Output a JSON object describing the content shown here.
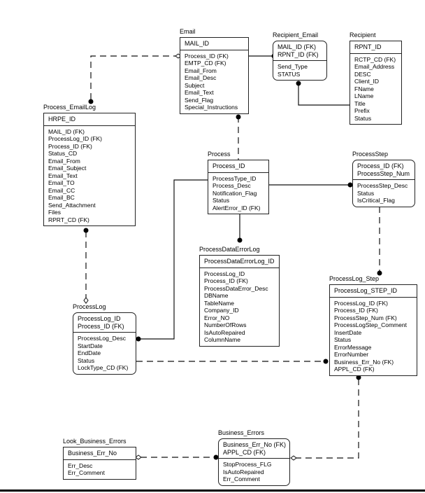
{
  "diagram": {
    "type": "entity-relationship",
    "entities": {
      "email": {
        "name": "Email",
        "keys": [
          "MAIL_ID"
        ],
        "attributes": [
          "Process_ID (FK)",
          "EMTP_CD (FK)",
          "Email_From",
          "Email_Desc",
          "Subject",
          "Email_Text",
          "Send_Flag",
          "Special_Instructions"
        ]
      },
      "recipient_email": {
        "name": "Recipient_Email",
        "keys": [
          "MAIL_ID (FK)",
          "RPNT_ID (FK)"
        ],
        "attributes": [
          "Send_Type",
          "STATUS"
        ]
      },
      "recipient": {
        "name": "Recipient",
        "keys": [
          "RPNT_ID"
        ],
        "attributes": [
          "RCTP_CD (FK)",
          "Email_Address",
          "DESC",
          "Client_ID",
          "FName",
          "LName",
          "Title",
          "Prefix",
          "Status"
        ]
      },
      "process_emaillog": {
        "name": "Process_EmailLog",
        "keys": [
          "HRPE_ID"
        ],
        "attributes": [
          "MAIL_ID (FK)",
          "ProcessLog_ID (FK)",
          "Process_ID (FK)",
          "Status_CD",
          "Email_From",
          "Email_Subject",
          "Email_Text",
          "Email_TO",
          "Email_CC",
          "Email_BC",
          "Send_Attachment",
          "Files",
          "RPRT_CD (FK)"
        ]
      },
      "process": {
        "name": "Process",
        "keys": [
          "Process_ID"
        ],
        "attributes": [
          "ProcessType_ID",
          "Process_Desc",
          "Notification_Flag",
          "Status",
          "AlertError_ID (FK)"
        ]
      },
      "process_step": {
        "name": "ProcessStep",
        "keys": [
          "Process_ID (FK)",
          "ProcessStep_Num"
        ],
        "attributes": [
          "ProcessStep_Desc",
          "Status",
          "IsCritical_Flag"
        ]
      },
      "process_data_error_log": {
        "name": "ProcessDataErrorLog",
        "keys": [
          "ProcessDataErrorLog_ID"
        ],
        "attributes": [
          "ProcessLog_ID",
          "Process_ID (FK)",
          "ProcessDataError_Desc",
          "DBName",
          "TableName",
          "Company_ID",
          "Error_NO",
          "NumberOfRows",
          "IsAutoRepaired",
          "ColumnName"
        ]
      },
      "process_log_step": {
        "name": "ProcessLog_Step",
        "keys": [
          "ProcessLog_STEP_ID"
        ],
        "attributes": [
          "ProcessLog_ID (FK)",
          "Process_ID (FK)",
          "ProcessStep_Num (FK)",
          "ProcessLogStep_Comment",
          "InsertDate",
          "Status",
          "ErrorMessage",
          "ErrorNumber",
          "Business_Err_No (FK)",
          "APPL_CD (FK)"
        ]
      },
      "process_log": {
        "name": "ProcessLog",
        "keys": [
          "ProcessLog_ID",
          "Process_ID (FK)"
        ],
        "attributes": [
          "ProcessLog_Desc",
          "StartDate",
          "EndDate",
          "Status",
          "LockType_CD (FK)"
        ]
      },
      "look_business_errors": {
        "name": "Look_Business_Errors",
        "keys": [
          "Business_Err_No"
        ],
        "attributes": [
          "Err_Desc",
          "Err_Comment"
        ]
      },
      "business_errors": {
        "name": "Business_Errors",
        "keys": [
          "Business_Err_No (FK)",
          "APPL_CD (FK)"
        ],
        "attributes": [
          "StopProcess_FLG",
          "IsAutoRepaired",
          "Err_Comment"
        ]
      }
    },
    "relationships": [
      {
        "from": "Email",
        "to": "Process_EmailLog",
        "style": "non-identifying",
        "parent_end": "diamond",
        "child_end": "dot"
      },
      {
        "from": "Email",
        "to": "Recipient_Email",
        "style": "identifying",
        "child_end": "dot"
      },
      {
        "from": "Recipient",
        "to": "Recipient_Email",
        "style": "identifying",
        "child_end": "dot"
      },
      {
        "from": "Process",
        "to": "Email",
        "style": "non-identifying",
        "child_end": "dot"
      },
      {
        "from": "Process",
        "to": "ProcessStep",
        "style": "identifying",
        "child_end": "dot"
      },
      {
        "from": "Process",
        "to": "ProcessDataErrorLog",
        "style": "identifying",
        "child_end": "dot"
      },
      {
        "from": "Process",
        "to": "ProcessLog",
        "style": "identifying",
        "child_end": "dot"
      },
      {
        "from": "ProcessLog",
        "to": "Process_EmailLog",
        "style": "non-identifying",
        "parent_end": "diamond",
        "child_end": "dot"
      },
      {
        "from": "ProcessStep",
        "to": "ProcessLog_Step",
        "style": "non-identifying",
        "child_end": "dot"
      },
      {
        "from": "ProcessLog",
        "to": "ProcessLog_Step",
        "style": "non-identifying",
        "child_end": "dot"
      },
      {
        "from": "Business_Errors",
        "to": "ProcessLog_Step",
        "style": "non-identifying",
        "parent_end": "diamond",
        "child_end": "dot"
      },
      {
        "from": "Look_Business_Errors",
        "to": "Business_Errors",
        "style": "non-identifying",
        "parent_end": "diamond",
        "child_end": "dot"
      }
    ]
  }
}
